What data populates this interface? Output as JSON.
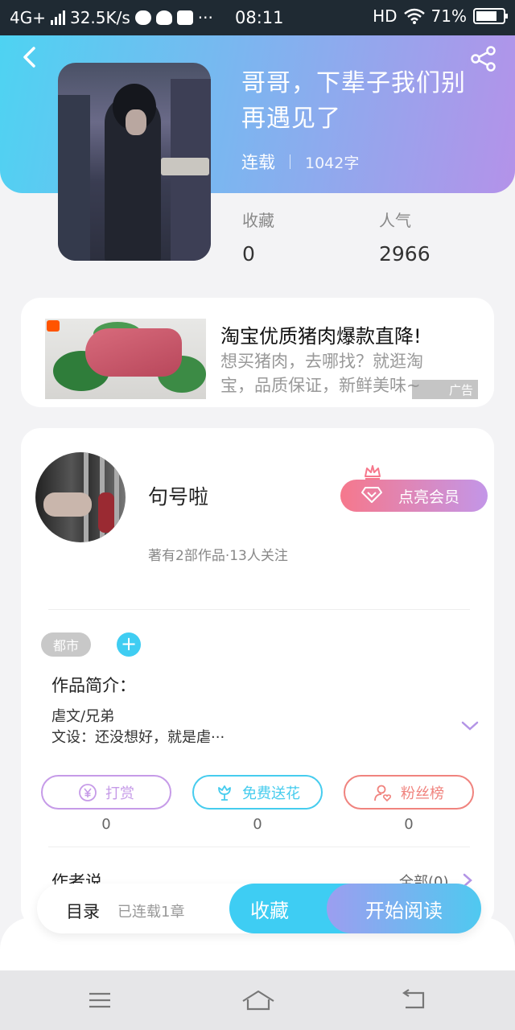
{
  "status_bar": {
    "network": "4G+",
    "speed": "32.5K/s",
    "dots": "···",
    "time": "08:11",
    "hd": "HD",
    "battery": "71%"
  },
  "book": {
    "title": "哥哥，下辈子我们别再遇见了",
    "status": "连载",
    "word_count": "1042字",
    "stats": [
      {
        "label": "收藏",
        "value": "0"
      },
      {
        "label": "人气",
        "value": "2966"
      }
    ]
  },
  "ad": {
    "title": "淘宝优质猪肉爆款直降!",
    "description": "想买猪肉，去哪找？就逛淘宝，品质保证，新鲜美味~",
    "tag": "广告"
  },
  "author": {
    "name": "句号啦",
    "info": "著有2部作品·13人关注",
    "vip_label": "点亮会员"
  },
  "tags": [
    "都市"
  ],
  "add_tag": "+",
  "intro": {
    "heading": "作品简介：",
    "line1": "虐文/兄弟",
    "line2": "文设：还没想好，就是虐···"
  },
  "actions": [
    {
      "label": "打赏",
      "count": "0",
      "color": "#c69be8"
    },
    {
      "label": "免费送花",
      "count": "0",
      "color": "#46ccee"
    },
    {
      "label": "粉丝榜",
      "count": "0",
      "color": "#f0837e"
    }
  ],
  "author_say": {
    "heading": "作者说",
    "all_link": "全部(0)"
  },
  "bottom_bar": {
    "toc": "目录",
    "chapters": "已连载1章",
    "favorite": "收藏",
    "start_reading": "开始阅读"
  }
}
